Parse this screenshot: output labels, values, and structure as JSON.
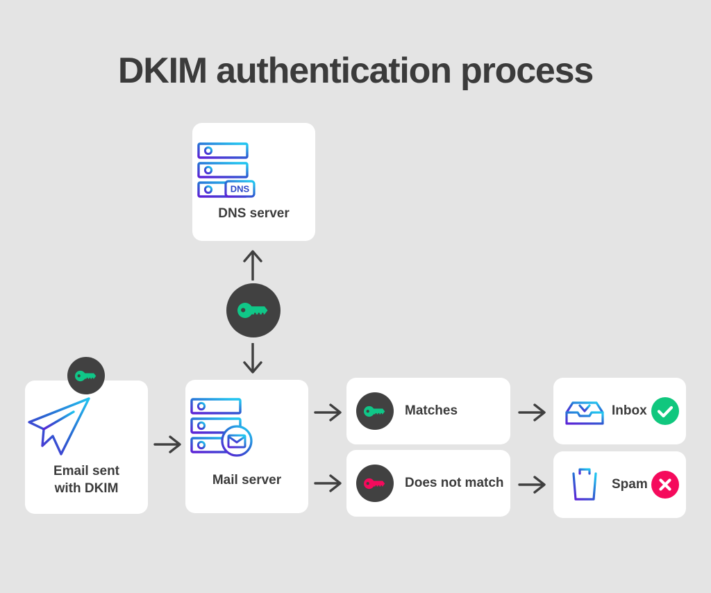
{
  "page": {
    "title": "DKIM authentication process",
    "background_color": "#e4e4e4",
    "card_color": "#ffffff"
  },
  "colors": {
    "title_text": "#3b3b3b",
    "body_text": "#3b3b3b",
    "badge_circle": "#414141",
    "key_green": "#10c788",
    "key_pink": "#f50a5c",
    "status_success": "#10c77e",
    "status_error": "#f50a5c",
    "icon_gradient_start": "#21c3ef",
    "icon_gradient_end": "#5b24d6",
    "arrow": "#3f3f3f"
  },
  "nodes": {
    "dns_server": {
      "label": "DNS server",
      "icon": "dns-server-rack-icon",
      "badge_text": "DNS"
    },
    "email_sent": {
      "label_line1": "Email sent",
      "label_line2": "with DKIM",
      "icon": "paper-plane-icon",
      "badge_icon": "key-icon"
    },
    "mail_server": {
      "label": "Mail server",
      "icon": "mail-server-rack-icon"
    },
    "key_center": {
      "icon": "key-icon"
    }
  },
  "results": [
    {
      "label": "Matches",
      "icon": "key-icon",
      "key_color": "#10c788"
    },
    {
      "label": "Does not match",
      "icon": "key-icon",
      "key_color": "#f50a5c"
    }
  ],
  "outcomes": [
    {
      "label": "Inbox",
      "icon": "inbox-tray-icon",
      "status_icon": "check-circle-icon",
      "status_color": "#10c77e"
    },
    {
      "label": "Spam",
      "icon": "trash-can-icon",
      "status_icon": "x-circle-icon",
      "status_color": "#f50a5c"
    }
  ],
  "arrows": [
    {
      "name": "key-to-dns-server",
      "direction": "up"
    },
    {
      "name": "key-to-mail-server",
      "direction": "down"
    },
    {
      "name": "email-to-mail-server",
      "direction": "right"
    },
    {
      "name": "mail-server-to-matches",
      "direction": "right"
    },
    {
      "name": "mail-server-to-does-not-match",
      "direction": "right"
    },
    {
      "name": "matches-to-inbox",
      "direction": "right"
    },
    {
      "name": "does-not-match-to-spam",
      "direction": "right"
    }
  ]
}
